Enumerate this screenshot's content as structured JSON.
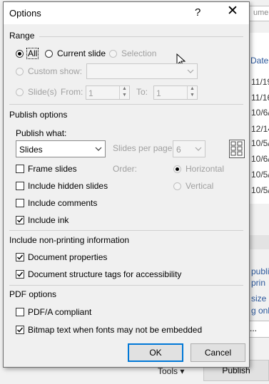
{
  "background": {
    "search_placeholder": "umen",
    "column_header": "Date",
    "dates": [
      "11/19",
      "11/16",
      "10/6/",
      "12/14",
      "10/5/",
      "10/6/",
      "10/5/",
      "10/5/",
      "10/6/"
    ],
    "links": [
      "publi",
      "prin",
      "size",
      "g onli"
    ],
    "dots_label": "...",
    "tools_label": "Tools",
    "publish_label": "Publish"
  },
  "dialog": {
    "title": "Options",
    "help_glyph": "?",
    "close_glyph": "✕",
    "range": {
      "label": "Range",
      "all": "All",
      "current_slide": "Current slide",
      "selection": "Selection",
      "custom_show": "Custom show:",
      "custom_show_value": "",
      "slides": "Slide(s)",
      "from": "From:",
      "from_value": "1",
      "to": "To:",
      "to_value": "1"
    },
    "publish_options": {
      "label": "Publish options",
      "publish_what": "Publish what:",
      "publish_what_value": "Slides",
      "slides_per_page": "Slides per page:",
      "slides_per_page_value": "6",
      "order": "Order:",
      "horizontal": "Horizontal",
      "vertical": "Vertical",
      "frame_slides": "Frame slides",
      "include_hidden": "Include hidden slides",
      "include_comments": "Include comments",
      "include_ink": "Include ink"
    },
    "nonprinting": {
      "label": "Include non-printing information",
      "doc_properties": "Document properties",
      "doc_structure": "Document structure tags for accessibility"
    },
    "pdf_options": {
      "label": "PDF options",
      "pdfa": "PDF/A compliant",
      "bitmap_text": "Bitmap text when fonts may not be embedded"
    },
    "ok": "OK",
    "cancel": "Cancel"
  }
}
